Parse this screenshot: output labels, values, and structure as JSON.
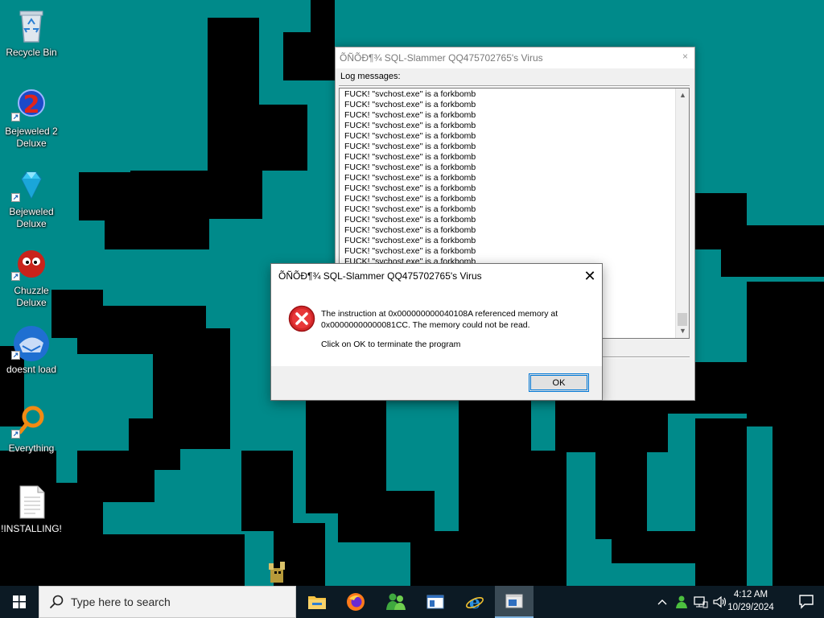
{
  "desktop": {
    "icons": [
      {
        "label": "Recycle Bin",
        "icon": "recycle-bin-icon",
        "shortcut": false
      },
      {
        "label": "Bejeweled 2 Deluxe",
        "icon": "bejeweled-2-icon",
        "shortcut": true
      },
      {
        "label": "Bejeweled Deluxe",
        "icon": "bejeweled-icon",
        "shortcut": true
      },
      {
        "label": "Chuzzle Deluxe",
        "icon": "chuzzle-icon",
        "shortcut": true
      },
      {
        "label": "doesnt load",
        "icon": "thunderbird-icon",
        "shortcut": true
      },
      {
        "label": "Everything",
        "icon": "everything-search-icon",
        "shortcut": true
      },
      {
        "label": "!INSTALLING!",
        "icon": "text-document-icon",
        "shortcut": false
      }
    ],
    "wallpaper_colors": {
      "background": "#008a8a",
      "foreground": "#000000"
    }
  },
  "log_window": {
    "title": "ÕÑÕÐ¶¾ SQL-Slammer QQ475702765's Virus",
    "close": "×",
    "group_label": "Log messages:",
    "lines": [
      "FUCK! \"svchost.exe\" is a forkbomb",
      "FUCK! \"svchost.exe\" is a forkbomb",
      "FUCK! \"svchost.exe\" is a forkbomb",
      "FUCK! \"svchost.exe\" is a forkbomb",
      "FUCK! \"svchost.exe\" is a forkbomb",
      "FUCK! \"svchost.exe\" is a forkbomb",
      "FUCK! \"svchost.exe\" is a forkbomb",
      "FUCK! \"svchost.exe\" is a forkbomb",
      "FUCK! \"svchost.exe\" is a forkbomb",
      "FUCK! \"svchost.exe\" is a forkbomb",
      "FUCK! \"svchost.exe\" is a forkbomb",
      "FUCK! \"svchost.exe\" is a forkbomb",
      "FUCK! \"svchost.exe\" is a forkbomb",
      "FUCK! \"svchost.exe\" is a forkbomb",
      "FUCK! \"svchost.exe\" is a forkbomb",
      "FUCK! \"svchost.exe\" is a forkbomb",
      "FUCK! \"svchost.exe\" is a forkbomb"
    ],
    "partial_text": "\""
  },
  "error_dialog": {
    "title": "ÕÑÕÐ¶¾ SQL-Slammer QQ475702765's Virus",
    "close": "✕",
    "message": "The instruction at 0x000000000040108A referenced memory at 0x00000000000081CC. The memory could not be read.",
    "instruction": "Click on OK to terminate the program",
    "ok_label": "OK",
    "icon": "error-icon"
  },
  "taskbar": {
    "search_placeholder": "Type here to search",
    "apps": [
      {
        "name": "file-explorer-icon",
        "active": false
      },
      {
        "name": "firefox-icon",
        "active": false
      },
      {
        "name": "msn-messenger-icon",
        "active": false
      },
      {
        "name": "window-app-icon",
        "active": false
      },
      {
        "name": "internet-explorer-icon",
        "active": false
      },
      {
        "name": "virus-window-icon",
        "active": true
      }
    ],
    "tray": {
      "chevron": "^",
      "time": "4:12 AM",
      "date": "10/29/2024"
    }
  }
}
